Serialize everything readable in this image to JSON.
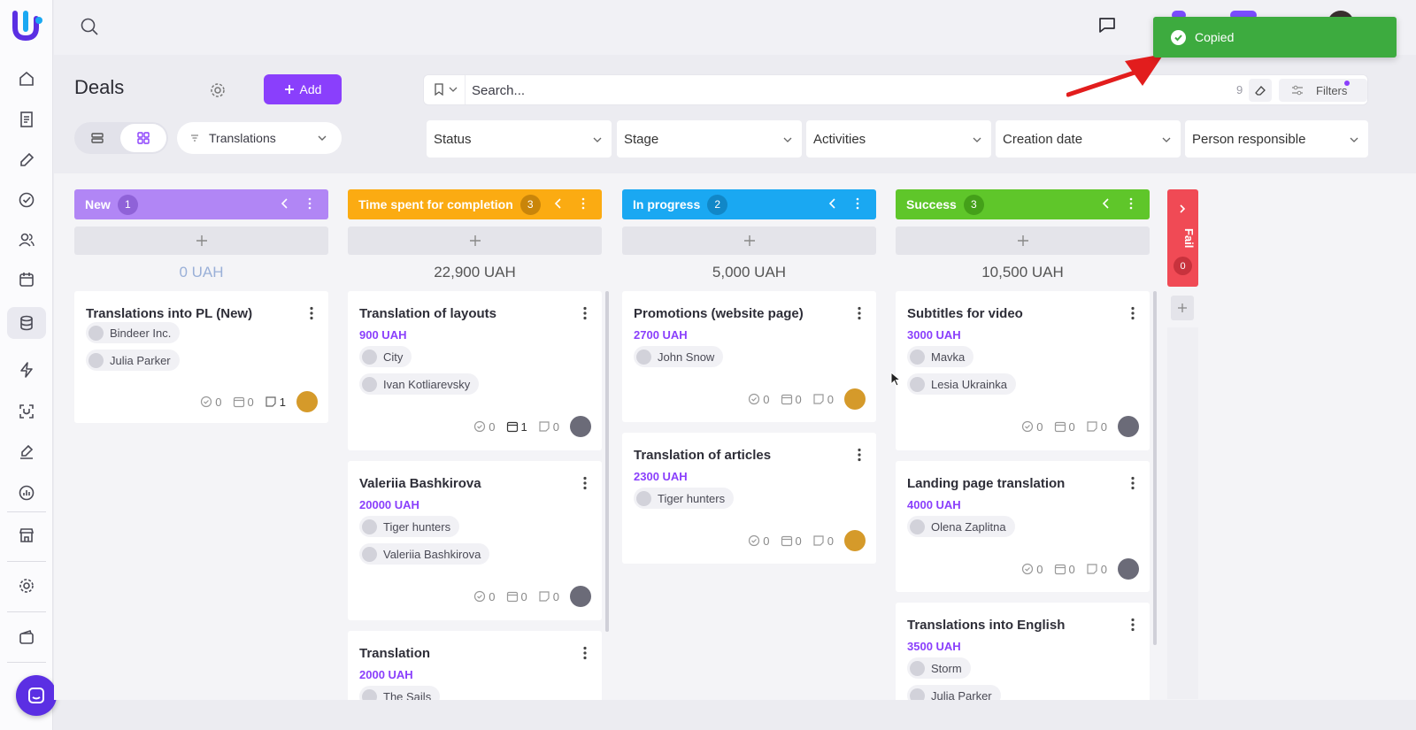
{
  "app": {
    "name": "Uspacy",
    "accent": "#8a3ffc"
  },
  "toast": {
    "text": "Copied",
    "color": "#3dab3f"
  },
  "header": {
    "title": "Deals",
    "add_label": "Add",
    "pipeline": "Translations",
    "badge1": "2",
    "badge2": "99+"
  },
  "search": {
    "placeholder": "Search...",
    "count": "9",
    "filters_label": "Filters"
  },
  "filters": [
    "Status",
    "Stage",
    "Activities",
    "Creation date",
    "Person responsible"
  ],
  "sidebar_icons": [
    "home-icon",
    "document-icon",
    "edit-icon",
    "check-circle-icon",
    "users-icon",
    "calendar-icon",
    "database-icon",
    "lightning-icon",
    "scan-icon",
    "pen-icon",
    "chart-icon",
    "store-icon",
    "settings-icon",
    "wallet-icon"
  ],
  "columns": [
    {
      "name": "New",
      "count": "1",
      "color": "#b186f5",
      "total": "0 UAH",
      "cards": [
        {
          "title": "Translations into PL (New)",
          "amount": "",
          "company": "Bindeer Inc.",
          "contact": "Julia Parker",
          "tasks": "0",
          "events": "0",
          "notes": "1"
        }
      ]
    },
    {
      "name": "Time spent for completion",
      "count": "3",
      "color": "#fbab12",
      "total": "22,900 UAH",
      "cards": [
        {
          "title": "Translation of layouts",
          "amount": "900 UAH",
          "company": "City",
          "contact": "Ivan Kotliarevsky",
          "tasks": "0",
          "events": "1",
          "notes": "0"
        },
        {
          "title": "Valeriia Bashkirova",
          "amount": "20000 UAH",
          "company": "Tiger hunters",
          "contact": "Valeriia Bashkirova",
          "tasks": "0",
          "events": "0",
          "notes": "0"
        },
        {
          "title": "Translation",
          "amount": "2000 UAH",
          "company": "The Sails",
          "contact": "",
          "tasks": "",
          "events": "",
          "notes": ""
        }
      ]
    },
    {
      "name": "In progress",
      "count": "2",
      "color": "#1aa8f2",
      "total": "5,000 UAH",
      "cards": [
        {
          "title": "Promotions (website page)",
          "amount": "2700 UAH",
          "company": "",
          "contact": "John Snow",
          "tasks": "0",
          "events": "0",
          "notes": "0"
        },
        {
          "title": "Translation of articles",
          "amount": "2300 UAH",
          "company": "Tiger hunters",
          "contact": "",
          "tasks": "0",
          "events": "0",
          "notes": "0"
        }
      ]
    },
    {
      "name": "Success",
      "count": "3",
      "color": "#5fc62a",
      "total": "10,500 UAH",
      "cards": [
        {
          "title": "Subtitles for video",
          "amount": "3000 UAH",
          "company": "Mavka",
          "contact": "Lesia Ukrainka",
          "tasks": "0",
          "events": "0",
          "notes": "0"
        },
        {
          "title": "Landing page translation",
          "amount": "4000 UAH",
          "company": "",
          "contact": "Olena Zaplitna",
          "tasks": "0",
          "events": "0",
          "notes": "0"
        },
        {
          "title": "Translations into English",
          "amount": "3500 UAH",
          "company": "Storm",
          "contact": "Julia Parker",
          "tasks": "",
          "events": "",
          "notes": ""
        }
      ]
    }
  ],
  "fail_column": {
    "name": "Fail",
    "count": "0",
    "color": "#f04a55"
  }
}
